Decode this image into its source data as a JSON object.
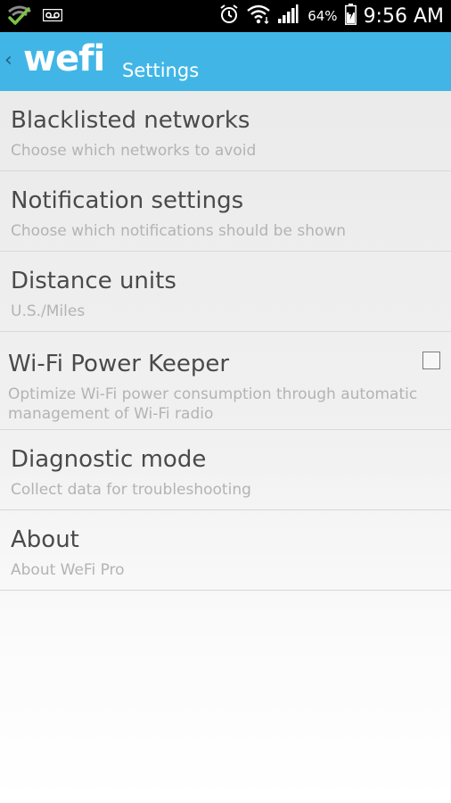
{
  "status_bar": {
    "left_icons": [
      "wifi-check-icon",
      "voicemail-icon"
    ],
    "right_icons": [
      "alarm-clock-icon",
      "wifi-signal-icon",
      "cell-signal-icon",
      "battery-charging-icon"
    ],
    "battery_percent": "64%",
    "time": "9:56 AM"
  },
  "action_bar": {
    "back_glyph": "‹",
    "logo": "wefi",
    "title": "Settings",
    "background_color": "#41b6e6"
  },
  "settings": {
    "items": [
      {
        "title": "Blacklisted networks",
        "summary": "Choose which networks to avoid"
      },
      {
        "title": "Notification settings",
        "summary": "Choose which notifications should be shown"
      },
      {
        "title": "Distance units",
        "summary": "U.S./Miles"
      },
      {
        "title": "Wi-Fi Power Keeper",
        "summary": "Optimize Wi-Fi power consumption through automatic management of Wi-Fi radio",
        "checked": false
      },
      {
        "title": "Diagnostic mode",
        "summary": "Collect data for troubleshooting"
      },
      {
        "title": "About",
        "summary": "About WeFi Pro"
      }
    ]
  }
}
